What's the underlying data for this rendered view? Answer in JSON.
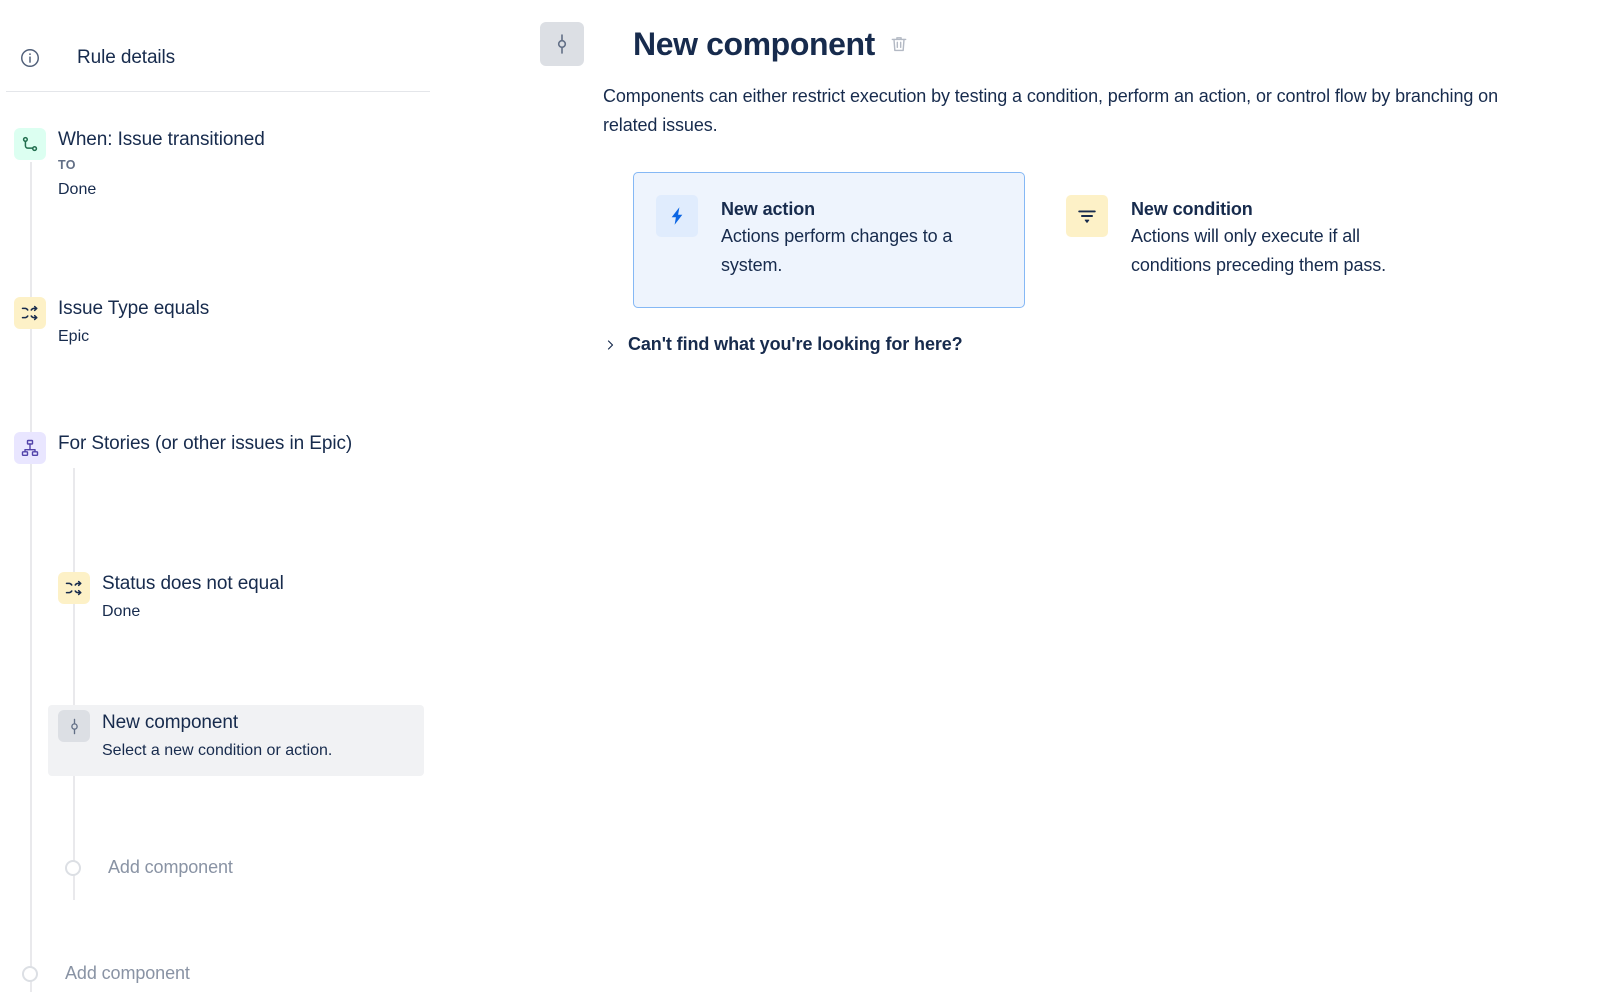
{
  "left_panel": {
    "header": {
      "icon": "info-circle-icon",
      "label": "Rule details"
    },
    "steps": [
      {
        "id": "when",
        "icon": "trigger-path-icon",
        "badge_color": "#dcfff1",
        "title": "When: Issue transitioned",
        "kicker": "TO",
        "sub": "Done"
      },
      {
        "id": "issue-type",
        "icon": "shuffle-icon",
        "badge_color": "#fdf1c7",
        "title": "Issue Type equals",
        "sub": "Epic"
      },
      {
        "id": "branch",
        "icon": "hierarchy-icon",
        "badge_color": "#e9e6ff",
        "title": "For Stories (or other issues in Epic)"
      },
      {
        "id": "status",
        "icon": "shuffle-icon",
        "badge_color": "#fdf1c7",
        "title": "Status does not equal",
        "sub": "Done"
      },
      {
        "id": "new-component",
        "icon": "component-node-icon",
        "badge_color": "#dcdfe4",
        "title": "New component",
        "sub": "Select a new condition or action.",
        "selected": true,
        "highlight_color": "#f1f2f4"
      }
    ],
    "add_component_nested": "Add component",
    "add_component_root": "Add component"
  },
  "right_panel": {
    "header": {
      "icon": "component-node-icon",
      "badge_color": "#dcdfe4",
      "title": "New component",
      "delete_icon": "trash-icon"
    },
    "description": "Components can either restrict execution by testing a condition, perform an action, or control flow by branching on related issues.",
    "options": [
      {
        "id": "new-action",
        "icon": "lightning-bolt-icon",
        "badge_color": "#e0ecfd",
        "title": "New action",
        "description": "Actions perform changes to a system.",
        "selected": true,
        "border_color": "#85b8f5",
        "fill_color": "#eef4fd"
      },
      {
        "id": "new-condition",
        "icon": "filter-icon",
        "badge_color": "#fdf1c7",
        "title": "New condition",
        "description": "Actions will only execute if all conditions preceding them pass.",
        "selected": false
      }
    ],
    "expander": {
      "icon": "chevron-right-icon",
      "label": "Can't find what you're looking for here?"
    }
  }
}
